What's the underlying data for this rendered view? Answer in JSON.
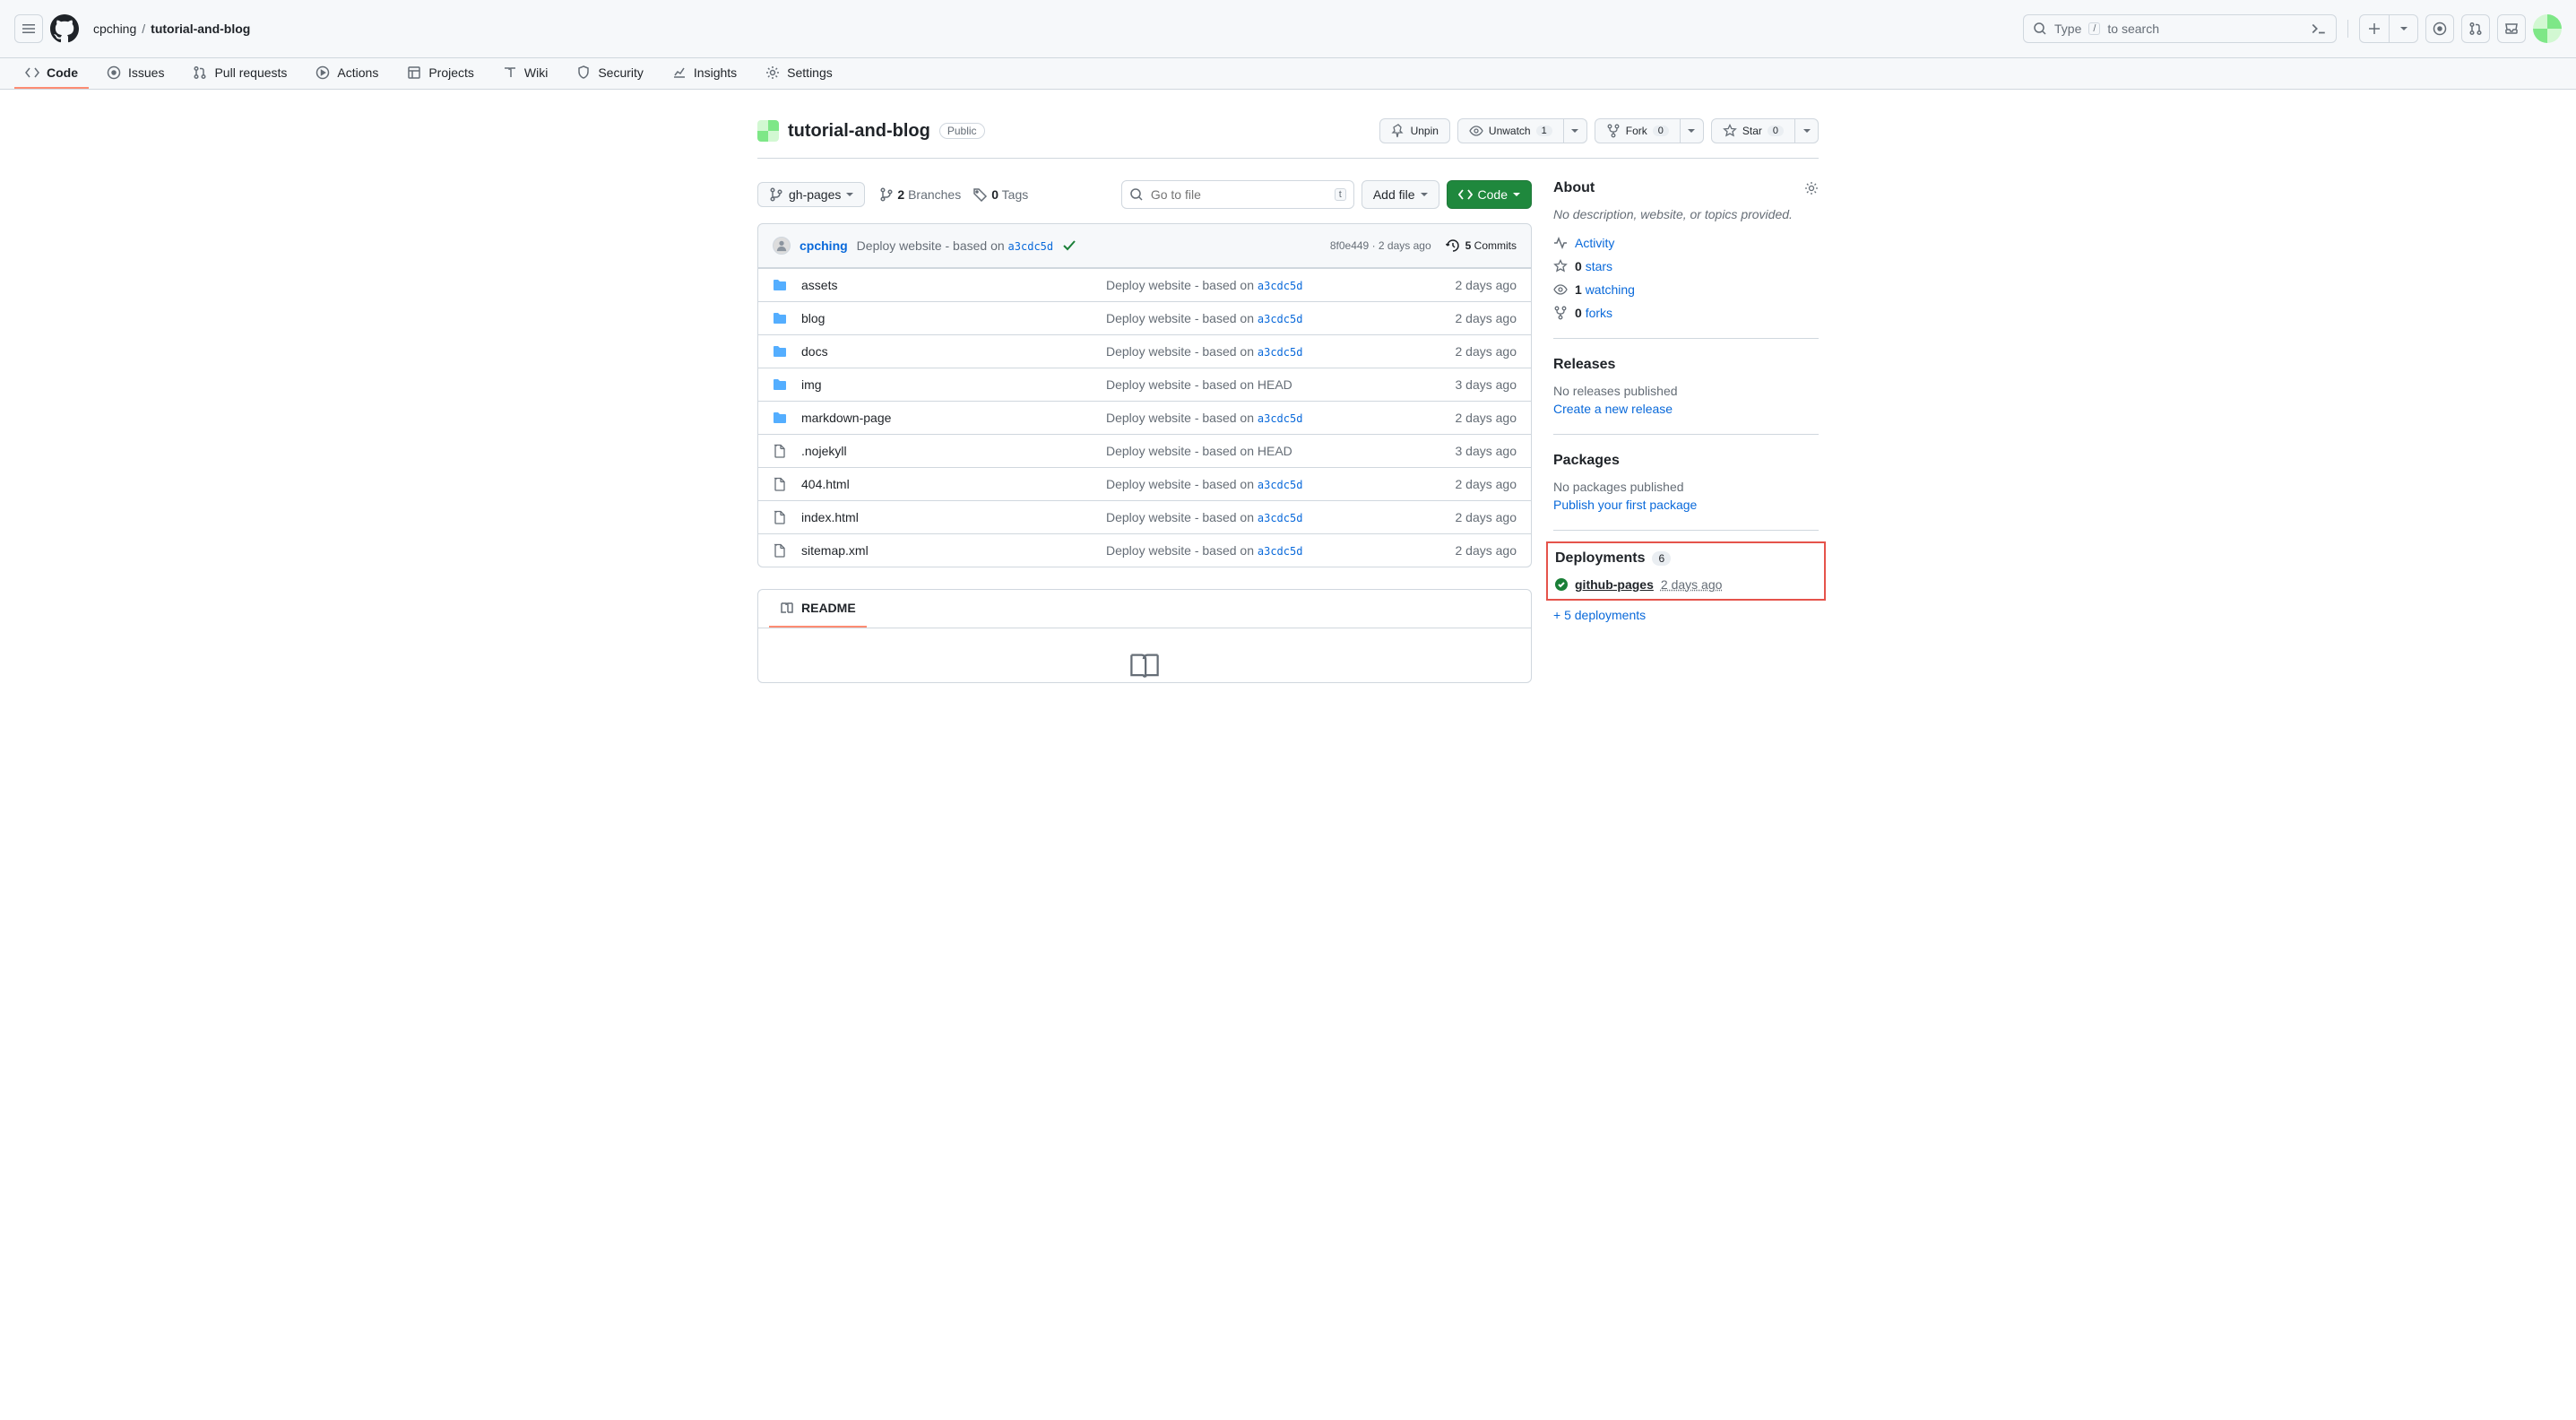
{
  "breadcrumb": {
    "owner": "cpching",
    "repo": "tutorial-and-blog"
  },
  "search": {
    "prompt_prefix": "Type ",
    "prompt_suffix": " to search",
    "kbd": "/"
  },
  "nav": {
    "code": "Code",
    "issues": "Issues",
    "pulls": "Pull requests",
    "actions": "Actions",
    "projects": "Projects",
    "wiki": "Wiki",
    "security": "Security",
    "insights": "Insights",
    "settings": "Settings"
  },
  "repo": {
    "name": "tutorial-and-blog",
    "visibility": "Public",
    "unpin": "Unpin",
    "unwatch": "Unwatch",
    "unwatch_count": "1",
    "fork": "Fork",
    "fork_count": "0",
    "star": "Star",
    "star_count": "0"
  },
  "branch": {
    "name": "gh-pages",
    "branches_count": "2",
    "branches_label": "Branches",
    "tags_count": "0",
    "tags_label": "Tags"
  },
  "file_nav": {
    "goto_placeholder": "Go to file",
    "goto_kbd": "t",
    "add_file": "Add file",
    "code_btn": "Code"
  },
  "commit": {
    "author": "cpching",
    "message_prefix": "Deploy website - based on ",
    "hash": "a3cdc5d",
    "short_sha": "8f0e449",
    "rel_time": "2 days ago",
    "commits_count": "5",
    "commits_label": "Commits"
  },
  "files": [
    {
      "type": "dir",
      "name": "assets",
      "msg": "Deploy website - based on ",
      "hash": "a3cdc5d",
      "date": "2 days ago"
    },
    {
      "type": "dir",
      "name": "blog",
      "msg": "Deploy website - based on ",
      "hash": "a3cdc5d",
      "date": "2 days ago"
    },
    {
      "type": "dir",
      "name": "docs",
      "msg": "Deploy website - based on ",
      "hash": "a3cdc5d",
      "date": "2 days ago"
    },
    {
      "type": "dir",
      "name": "img",
      "msg": "Deploy website - based on HEAD",
      "hash": "",
      "date": "3 days ago"
    },
    {
      "type": "dir",
      "name": "markdown-page",
      "msg": "Deploy website - based on ",
      "hash": "a3cdc5d",
      "date": "2 days ago"
    },
    {
      "type": "file",
      "name": ".nojekyll",
      "msg": "Deploy website - based on HEAD",
      "hash": "",
      "date": "3 days ago"
    },
    {
      "type": "file",
      "name": "404.html",
      "msg": "Deploy website - based on ",
      "hash": "a3cdc5d",
      "date": "2 days ago"
    },
    {
      "type": "file",
      "name": "index.html",
      "msg": "Deploy website - based on ",
      "hash": "a3cdc5d",
      "date": "2 days ago"
    },
    {
      "type": "file",
      "name": "sitemap.xml",
      "msg": "Deploy website - based on ",
      "hash": "a3cdc5d",
      "date": "2 days ago"
    }
  ],
  "readme": {
    "tab": "README"
  },
  "sidebar": {
    "about_title": "About",
    "about_desc": "No description, website, or topics provided.",
    "activity": "Activity",
    "stars_count": "0",
    "stars_label": "stars",
    "watching_count": "1",
    "watching_label": "watching",
    "forks_count": "0",
    "forks_label": "forks",
    "releases_title": "Releases",
    "releases_none": "No releases published",
    "releases_create": "Create a new release",
    "packages_title": "Packages",
    "packages_none": "No packages published",
    "packages_create": "Publish your first package",
    "deployments_title": "Deployments",
    "deployments_count": "6",
    "deploy_env": "github-pages",
    "deploy_time": "2 days ago",
    "deploy_more": "+ 5 deployments"
  }
}
